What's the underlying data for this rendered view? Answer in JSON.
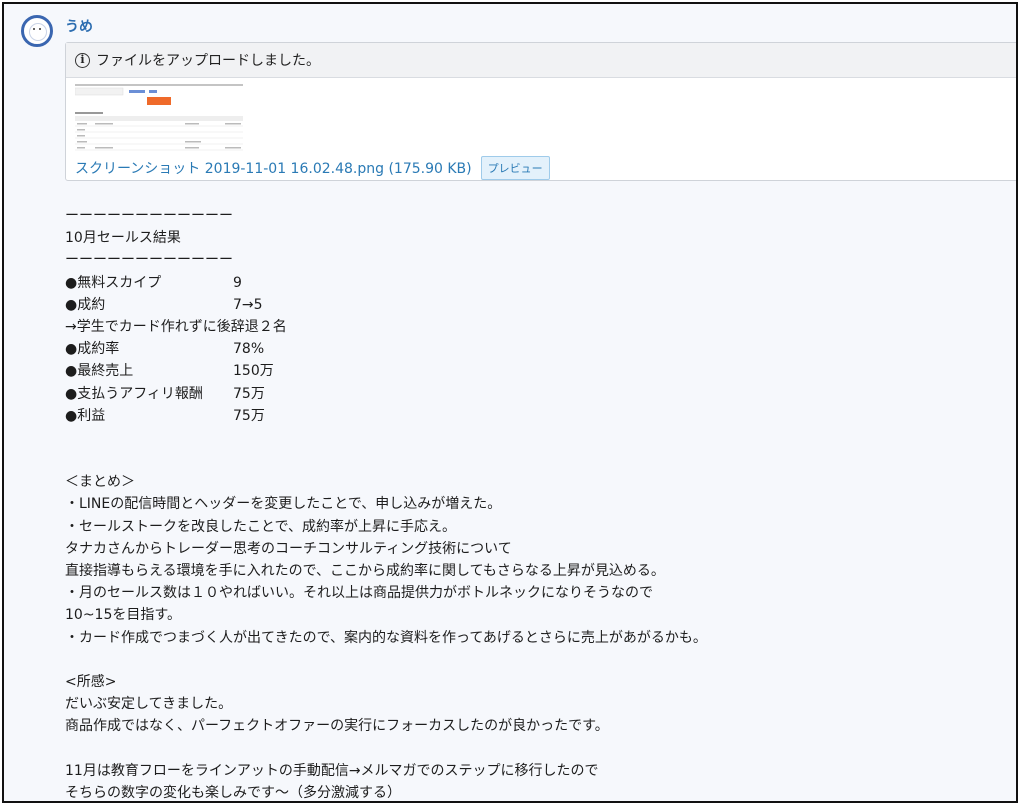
{
  "user": {
    "name": "うめ"
  },
  "attachment": {
    "notice": "ファイルをアップロードしました。",
    "filename": "スクリーンショット 2019-11-01 16.02.48.png (175.90 KB)",
    "preview_label": "プレビュー"
  },
  "message": {
    "divider": "ーーーーーーーーーーーー",
    "title": "10月セールス結果",
    "stats": [
      {
        "label": "●無料スカイプ",
        "value": "9"
      },
      {
        "label": "●成約",
        "value": "7→5"
      }
    ],
    "stats_note": "→学生でカード作れずに後辞退２名",
    "stats2": [
      {
        "label": "●成約率",
        "value": "78%"
      },
      {
        "label": "●最終売上",
        "value": "150万"
      },
      {
        "label": "●支払うアフィリ報酬",
        "value": "75万"
      },
      {
        "label": "●利益",
        "value": "75万"
      }
    ],
    "summary_heading": "＜まとめ＞",
    "summary_lines": [
      "・LINEの配信時間とヘッダーを変更したことで、申し込みが増えた。",
      "・セールストークを改良したことで、成約率が上昇に手応え。",
      "タナカさんからトレーダー思考のコーチコンサルティング技術について",
      "直接指導もらえる環境を手に入れたので、ここから成約率に関してもさらなる上昇が見込める。",
      "・月のセールス数は１０やればいい。それ以上は商品提供力がボトルネックになりそうなので",
      "10~15を目指す。",
      "・カード作成でつまづく人が出てきたので、案内的な資料を作ってあげるとさらに売上があがるかも。"
    ],
    "impressions_heading": "<所感>",
    "impressions_lines": [
      "だいぶ安定してきました。",
      "商品作成ではなく、パーフェクトオファーの実行にフォーカスしたのが良かったです。"
    ],
    "closing_lines": [
      "11月は教育フローをラインアットの手動配信→メルマガでのステップに移行したので",
      "そちらの数字の変化も楽しみです〜（多分激減する）"
    ]
  }
}
